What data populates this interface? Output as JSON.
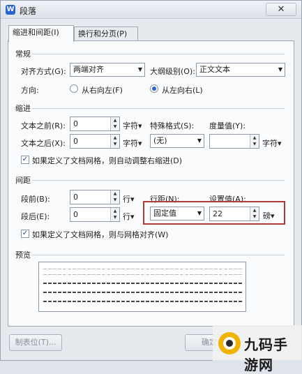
{
  "window": {
    "title": "段落",
    "close_symbol": "✕",
    "app_icon_letter": "W"
  },
  "tabs": [
    {
      "label": "缩进和间距(I)",
      "active": true
    },
    {
      "label": "换行和分页(P)",
      "active": false
    }
  ],
  "general": {
    "section_title": "常规",
    "alignment_label": "对齐方式(G):",
    "alignment_value": "两端对齐",
    "outline_label": "大纲级别(O):",
    "outline_value": "正文文本",
    "direction_label": "方向:",
    "direction_rtl": "从右向左(F)",
    "direction_ltr": "从左向右(L)",
    "direction_selected": "ltr"
  },
  "indent": {
    "section_title": "缩进",
    "before_label": "文本之前(R):",
    "before_value": "0",
    "before_unit": "字符▾",
    "after_label": "文本之后(X):",
    "after_value": "0",
    "after_unit": "字符▾",
    "special_label": "特殊格式(S):",
    "special_value": "(无)",
    "measure_label": "度量值(Y):",
    "measure_value": "",
    "measure_unit": "字符▾",
    "grid_checkbox_label": "如果定义了文档网格，则自动调整右缩进(D)",
    "grid_checked": true
  },
  "spacing": {
    "section_title": "间距",
    "before_label": "段前(B):",
    "before_value": "0",
    "before_unit": "行▾",
    "after_label": "段后(E):",
    "after_value": "0",
    "after_unit": "行▾",
    "line_spacing_label": "行距(N):",
    "line_spacing_value": "固定值",
    "set_value_label": "设置值(A):",
    "set_value": "22",
    "set_value_unit": "磅▾",
    "grid_checkbox_label": "如果定义了文档网格，则与网格对齐(W)",
    "grid_checked": true
  },
  "preview": {
    "section_title": "预览"
  },
  "footer": {
    "tabs_button": "制表位(T)...",
    "ok_button": "确定"
  },
  "watermark": {
    "text": "九码手游网"
  },
  "colors": {
    "accent": "#2a63d0",
    "highlight_border": "#b33a3a"
  }
}
